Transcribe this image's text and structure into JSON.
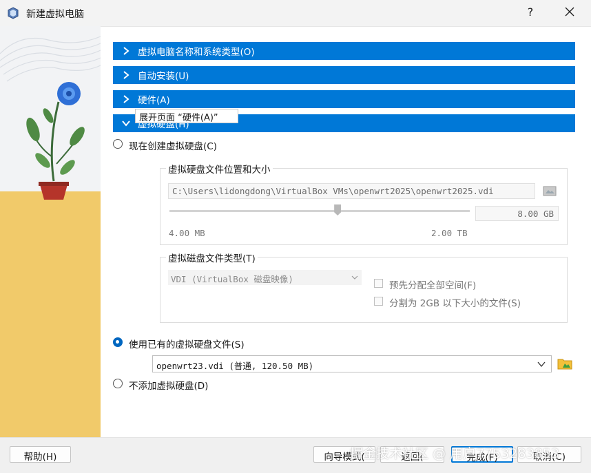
{
  "window": {
    "title": "新建虚拟电脑",
    "help_glyph": "?"
  },
  "sections": [
    {
      "label": "虚拟电脑名称和系统类型(O)"
    },
    {
      "label": "自动安装(U)"
    },
    {
      "label": "硬件(A)"
    },
    {
      "label": "虚拟硬盘(H)"
    }
  ],
  "tooltip": "展开页面 “硬件(A)”",
  "disk": {
    "create_new_label": "现在创建虚拟硬盘(C)",
    "location_group_title": "虚拟硬盘文件位置和大小",
    "file_path": "C:\\Users\\lidongdong\\VirtualBox VMs\\openwrt2025\\openwrt2025.vdi",
    "size_value": "8.00 GB",
    "size_fraction": 0.56,
    "size_min_label": "4.00 MB",
    "size_max_label": "2.00 TB",
    "type_group_title": "虚拟磁盘文件类型(T)",
    "type_selected": "VDI (VirtualBox 磁盘映像)",
    "preallocate_label": "预先分配全部空间(F)",
    "split_label": "分割为 2GB 以下大小的文件(S)",
    "use_existing_label": "使用已有的虚拟硬盘文件(S)",
    "existing_file": "openwrt23.vdi (普通, 120.50 MB)",
    "no_disk_label": "不添加虚拟硬盘(D)"
  },
  "footer": {
    "help": "帮助(H)",
    "guided": "向导模式(",
    "back": "返回(",
    "finish": "完成(F)",
    "cancel": "取消(C)"
  },
  "watermark": "掘金技术社区 @ 用户7753283853",
  "colors": {
    "accent": "#0078d7",
    "side_top": "#f2f3f5",
    "side_bottom": "#f1ca6a"
  },
  "icons": [
    "virtualbox-icon",
    "close-icon",
    "chevron-right-icon",
    "chevron-down-icon",
    "folder-icon",
    "folder-add-icon",
    "flower-illustration"
  ]
}
